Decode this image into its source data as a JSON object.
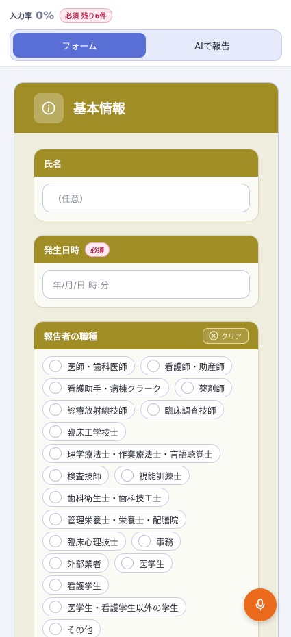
{
  "progress": {
    "label": "入力率",
    "value": "0%",
    "required_badge": "必須 残り6件"
  },
  "tabs": [
    {
      "label": "フォーム",
      "active": true
    },
    {
      "label": "AIで報告",
      "active": false
    }
  ],
  "section": {
    "title": "基本情報",
    "icon": "info-icon"
  },
  "fields": {
    "name": {
      "label": "氏名",
      "placeholder": "（任意）"
    },
    "datetime": {
      "label": "発生日時",
      "required_badge": "必須",
      "placeholder": "年/月/日 時:分"
    },
    "occupation": {
      "label": "報告者の職種",
      "clear_label": "クリア",
      "rows": [
        [
          "医師・歯科医師",
          "看護師・助産師"
        ],
        [
          "看護助手・病棟クラーク",
          "薬剤師"
        ],
        [
          "診療放射線技師",
          "臨床調査技師"
        ],
        [
          "臨床工学技士"
        ],
        [
          "理学療法士・作業療法士・言語聴覚士"
        ],
        [
          "検査技師",
          "視能訓練士"
        ],
        [
          "歯科衛生士・歯科技工士"
        ],
        [
          "管理栄養士・栄養士・配膳院"
        ],
        [
          "臨床心理技士",
          "事務"
        ],
        [
          "外部業者",
          "医学生"
        ],
        [
          "看護学生"
        ],
        [
          "医学生・看護学生以外の学生"
        ],
        [
          "その他"
        ]
      ]
    }
  },
  "fab": {
    "icon": "microphone-icon"
  },
  "colors": {
    "section_header": "#a08d25",
    "accent": "#5a6fd6",
    "fab": "#ec6a1c",
    "required": "#b3264a"
  }
}
